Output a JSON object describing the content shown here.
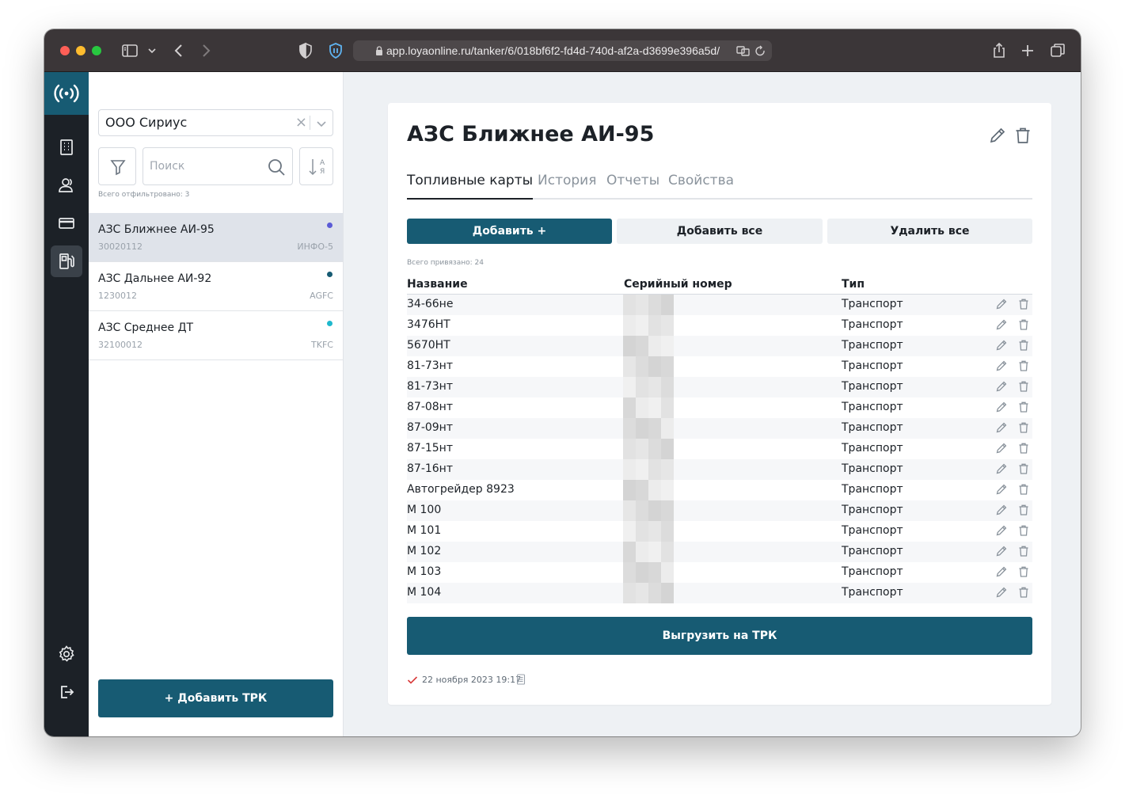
{
  "browser": {
    "url": "app.loyaonline.ru/tanker/6/018bf6f2-fd4d-740d-af2a-d3699e396a5d/"
  },
  "sidebar": {
    "organization": "ООО Сириус",
    "search_placeholder": "Поиск",
    "filtered_count": "Всего отфильтровано: 3",
    "stations": [
      {
        "name": "АЗС Ближнее АИ-95",
        "code": "30020112",
        "tag": "ИНФО-5",
        "dot_color": "#5b5bd6",
        "selected": true
      },
      {
        "name": "АЗС Дальнее АИ-92",
        "code": "1230012",
        "tag": "AGFC",
        "dot_color": "#175b73",
        "selected": false
      },
      {
        "name": "АЗС Среднее ДТ",
        "code": "32100012",
        "tag": "TKFC",
        "dot_color": "#1fb8cd",
        "selected": false
      }
    ],
    "add_button": "+ Добавить ТРК"
  },
  "main": {
    "title": "АЗС Ближнее АИ-95",
    "tabs": [
      {
        "label": "Топливные карты",
        "active": true
      },
      {
        "label": "История",
        "active": false
      },
      {
        "label": "Отчеты",
        "active": false
      },
      {
        "label": "Свойства",
        "active": false
      }
    ],
    "buttons": {
      "add": "Добавить +",
      "add_all": "Добавить все",
      "delete_all": "Удалить все"
    },
    "linked_count": "Всего привязано: 24",
    "table": {
      "headers": [
        "Название",
        "Серийный номер",
        "Тип"
      ],
      "rows": [
        {
          "name": "34-66не",
          "type": "Транспорт"
        },
        {
          "name": "3476НТ",
          "type": "Транспорт"
        },
        {
          "name": "5670НТ",
          "type": "Транспорт"
        },
        {
          "name": "81-73нт",
          "type": "Транспорт"
        },
        {
          "name": "81-73нт",
          "type": "Транспорт"
        },
        {
          "name": "87-08нт",
          "type": "Транспорт"
        },
        {
          "name": "87-09нт",
          "type": "Транспорт"
        },
        {
          "name": "87-15нт",
          "type": "Транспорт"
        },
        {
          "name": "87-16нт",
          "type": "Транспорт"
        },
        {
          "name": "Автогрейдер 8923",
          "type": "Транспорт"
        },
        {
          "name": "М 100",
          "type": "Транспорт"
        },
        {
          "name": "М 101",
          "type": "Транспорт"
        },
        {
          "name": "М 102",
          "type": "Транспорт"
        },
        {
          "name": "М 103",
          "type": "Транспорт"
        },
        {
          "name": "М 104",
          "type": "Транспорт"
        }
      ]
    },
    "upload_button": "Выгрузить на ТРК",
    "sync_date": "22 ноября 2023 19:17"
  },
  "colors": {
    "accent": "#175b73",
    "rail": "#1c2127",
    "error_check": "#d93b3b"
  }
}
